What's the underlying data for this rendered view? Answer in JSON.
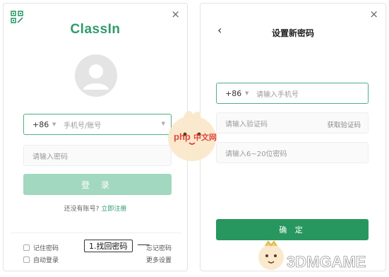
{
  "left_panel": {
    "logo_text": "ClassIn",
    "close_label": "×",
    "phone_field": {
      "country_code": "+86",
      "placeholder": "手机号/账号"
    },
    "password_field": {
      "placeholder": "请输入密码"
    },
    "login_label": "登 录",
    "register_prompt": "还没有账号?",
    "register_link": "立即注册",
    "remember_label": "记住密码",
    "auto_login_label": "自动登录",
    "forgot_label": "忘记密码",
    "more_settings_label": "更多设置",
    "annotation": "1.找回密码"
  },
  "right_panel": {
    "close_label": "×",
    "back_label": "‹",
    "title": "设置新密码",
    "phone_field": {
      "country_code": "+86",
      "placeholder": "请输入手机号"
    },
    "code_field": {
      "placeholder": "请输入验证码",
      "action": "获取验证码"
    },
    "password_field": {
      "placeholder": "请输入6~20位密码"
    },
    "confirm_label": "确 定"
  },
  "watermarks": {
    "php": "php 中文网",
    "game": "3DMGAME"
  },
  "colors": {
    "brand_green": "#2f9b6b",
    "login_disabled": "#a2d8bf",
    "confirm_green": "#27975f",
    "focus_border": "#4fb083"
  }
}
